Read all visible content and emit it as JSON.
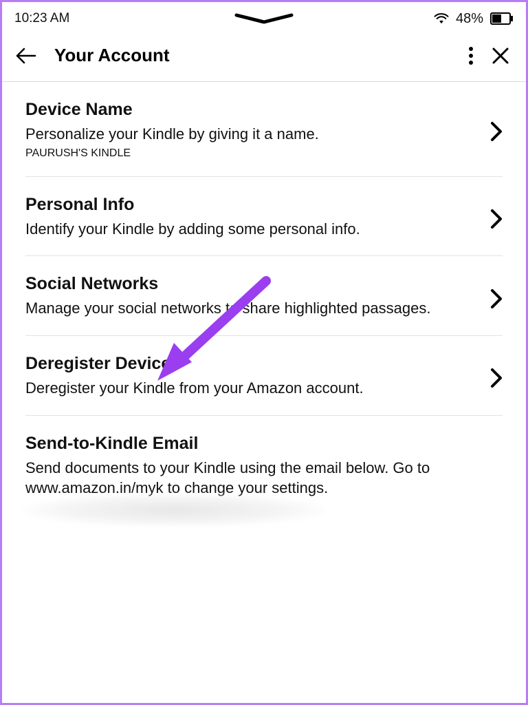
{
  "statusbar": {
    "time": "10:23 AM",
    "battery_pct": "48%"
  },
  "header": {
    "title": "Your Account"
  },
  "rows": {
    "device_name": {
      "title": "Device Name",
      "desc": "Personalize your Kindle by giving it a name.",
      "sub": "PAURUSH'S KINDLE"
    },
    "personal_info": {
      "title": "Personal Info",
      "desc": "Identify your Kindle by adding some personal info."
    },
    "social_networks": {
      "title": "Social Networks",
      "desc": "Manage your social networks to share highlighted passages."
    },
    "deregister": {
      "title": "Deregister Device",
      "desc": "Deregister your Kindle from your Amazon account."
    },
    "send_to_kindle": {
      "title": "Send-to-Kindle Email",
      "desc": "Send documents to your Kindle using the email below. Go to www.amazon.in/myk to change your settings."
    }
  },
  "annotation": {
    "arrow_color": "#9a3ef0"
  }
}
